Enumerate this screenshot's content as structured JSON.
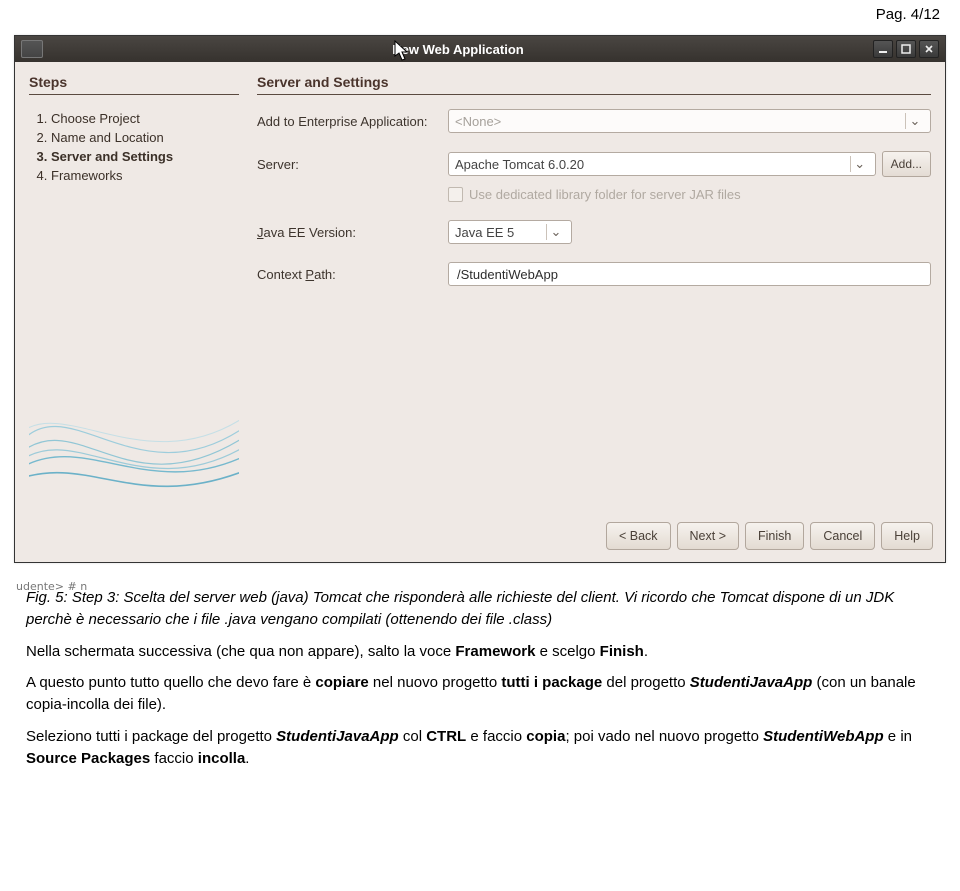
{
  "page_header": "Pag. 4/12",
  "dialog": {
    "title": "New Web Application",
    "steps_heading": "Steps",
    "steps": [
      {
        "label": "Choose Project",
        "active": false
      },
      {
        "label": "Name and Location",
        "active": false
      },
      {
        "label": "Server and Settings",
        "active": true
      },
      {
        "label": "Frameworks",
        "active": false
      }
    ],
    "form_heading": "Server and Settings",
    "labels": {
      "add_to_app": "Add to Enterprise Application:",
      "server": "Server:",
      "java_ee": "Java EE Version:",
      "context": "Context Path:"
    },
    "accelerators": {
      "java_ee": "J",
      "context": "P"
    },
    "values": {
      "add_to_app": "<None>",
      "server": "Apache Tomcat 6.0.20",
      "java_ee": "Java EE 5",
      "context": "/StudentiWebApp"
    },
    "checkbox_label": "Use dedicated library folder for server JAR files",
    "buttons": {
      "add": "Add...",
      "back": "< Back",
      "next": "Next >",
      "finish": "Finish",
      "cancel": "Cancel",
      "help": "Help"
    }
  },
  "caption": "Fig. 5: Step 3: Scelta del server web (java) Tomcat che risponderà alle richieste del client. Vi ricordo che Tomcat dispone di un JDK perchè è necessario che i file .java vengano compilati (ottenendo dei file .class)",
  "para1_a": "Nella schermata successiva (che qua non appare), salto la voce ",
  "para1_b": "Framework",
  "para1_c": " e scelgo ",
  "para1_d": "Finish",
  "para1_e": ".",
  "para2_a": "A questo punto tutto quello che devo fare è ",
  "para2_b": "copiare",
  "para2_c": " nel nuovo progetto ",
  "para2_d": "tutti i package",
  "para2_e": " del progetto ",
  "para2_f": "StudentiJavaApp",
  "para2_g": " (con un banale copia-incolla dei file).",
  "para3_a": "Seleziono tutti i package del progetto ",
  "para3_b": "StudentiJavaApp",
  "para3_c": " col ",
  "para3_d": "CTRL",
  "para3_e": " e faccio ",
  "para3_f": "copia",
  "para3_g": "; poi vado nel nuovo progetto ",
  "para3_h": "StudentiWebApp",
  "para3_i": " e in ",
  "para3_j": "Source Packages",
  "para3_k": " faccio ",
  "para3_l": "incolla",
  "para3_m": ".",
  "bg_snippets": {
    "left": "udente> # n"
  }
}
